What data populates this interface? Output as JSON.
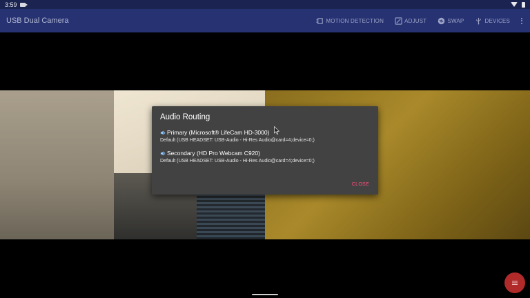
{
  "status_bar": {
    "time": "3:59"
  },
  "app_bar": {
    "title": "USB Dual Camera",
    "actions": [
      {
        "label": "MOTION DETECTION",
        "icon": "motion-detection-icon"
      },
      {
        "label": "ADJUST",
        "icon": "adjust-icon"
      },
      {
        "label": "SWAP",
        "icon": "swap-icon"
      },
      {
        "label": "DEVICES",
        "icon": "usb-icon"
      }
    ]
  },
  "dialog": {
    "title": "Audio Routing",
    "routes": [
      {
        "name": "Primary (Microsoft® LifeCam HD-3000)",
        "device": "Default (USB HEADSET: USB-Audio - Hi-Res Audio@card=4;device=0;)"
      },
      {
        "name": "Secondary (HD Pro Webcam C920)",
        "device": "Default (USB HEADSET: USB-Audio - Hi-Res Audio@card=4;device=0;)"
      }
    ],
    "close_label": "CLOSE"
  },
  "colors": {
    "app_bar": "#263272",
    "status_bar": "#1b2350",
    "dialog_bg": "#424242",
    "accent": "#ff4f81",
    "fab": "#b02a2a"
  }
}
